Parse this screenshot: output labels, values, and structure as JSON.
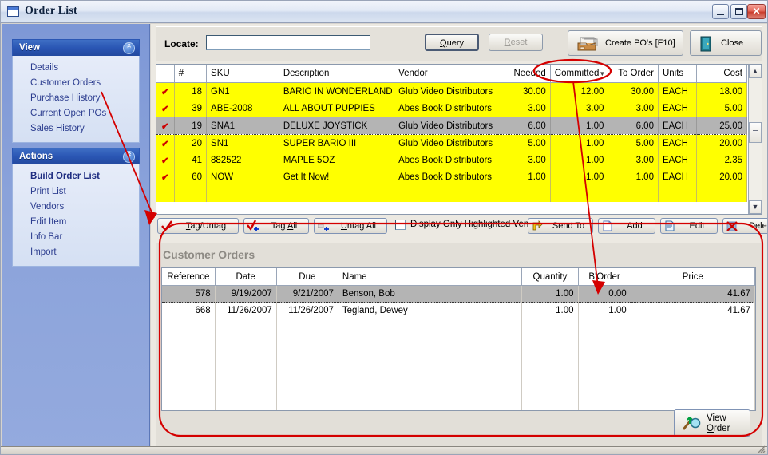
{
  "window": {
    "title": "Order List",
    "controls": {
      "minimize": "_",
      "maximize": "□",
      "close": "✕"
    }
  },
  "sidebar": {
    "panels": [
      {
        "title": "View",
        "collapse_icon": "chevron-up-icon",
        "items": [
          {
            "label": "Details",
            "bold": false
          },
          {
            "label": "Customer Orders",
            "bold": false
          },
          {
            "label": "Purchase History",
            "bold": false
          },
          {
            "label": "Current Open POs",
            "bold": false
          },
          {
            "label": "Sales History",
            "bold": false
          }
        ]
      },
      {
        "title": "Actions",
        "collapse_icon": "chevron-up-icon",
        "items": [
          {
            "label": "Build Order List",
            "bold": true
          },
          {
            "label": "Print List",
            "bold": false
          },
          {
            "label": "Vendors",
            "bold": false
          },
          {
            "label": "Edit Item",
            "bold": false
          },
          {
            "label": "Info Bar",
            "bold": false
          },
          {
            "label": "Import",
            "bold": false
          }
        ]
      }
    ]
  },
  "toolbar": {
    "locate_label": "Locate:",
    "locate_value": "",
    "locate_placeholder": "",
    "query_label": "Query",
    "query_accel": "Q",
    "reset_label": "Reset",
    "reset_accel": "R",
    "reset_disabled": true,
    "create_po_label": "Create PO's [F10]",
    "close_label": "Close"
  },
  "order_grid": {
    "columns": [
      "",
      "#",
      "SKU",
      "Description",
      "Vendor",
      "Needed",
      "Committed",
      "To Order",
      "Units",
      "Cost"
    ],
    "sorted_column": "Committed",
    "sort_indicator": "▼",
    "rows": [
      {
        "tagged": "✔",
        "num": "18",
        "sku": "GN1",
        "description": "BARIO IN WONDERLAND",
        "vendor": "Glub Video Distributors",
        "needed": "30.00",
        "committed": "12.00",
        "to_order": "30.00",
        "units": "EACH",
        "cost": "18.00",
        "selected": false
      },
      {
        "tagged": "✔",
        "num": "39",
        "sku": "ABE-2008",
        "description": "ALL ABOUT PUPPIES",
        "vendor": "Abes Book Distributors",
        "needed": "3.00",
        "committed": "3.00",
        "to_order": "3.00",
        "units": "EACH",
        "cost": "5.00",
        "selected": false
      },
      {
        "tagged": "✔",
        "num": "19",
        "sku": "SNA1",
        "description": "DELUXE JOYSTICK",
        "vendor": "Glub Video Distributors",
        "needed": "6.00",
        "committed": "1.00",
        "to_order": "6.00",
        "units": "EACH",
        "cost": "25.00",
        "selected": true
      },
      {
        "tagged": "✔",
        "num": "20",
        "sku": "SN1",
        "description": "SUPER BARIO III",
        "vendor": "Glub Video Distributors",
        "needed": "5.00",
        "committed": "1.00",
        "to_order": "5.00",
        "units": "EACH",
        "cost": "20.00",
        "selected": false
      },
      {
        "tagged": "✔",
        "num": "41",
        "sku": "882522",
        "description": "MAPLE 5OZ",
        "vendor": "Abes Book Distributors",
        "needed": "3.00",
        "committed": "1.00",
        "to_order": "3.00",
        "units": "EACH",
        "cost": "2.35",
        "selected": false
      },
      {
        "tagged": "✔",
        "num": "60",
        "sku": "NOW",
        "description": "Get It Now!",
        "vendor": "Abes Book Distributors",
        "needed": "1.00",
        "committed": "1.00",
        "to_order": "1.00",
        "units": "EACH",
        "cost": "20.00",
        "selected": false
      }
    ],
    "scrollbar": {
      "up": "▲",
      "down": "▼"
    }
  },
  "action_bar": {
    "tag_untag_label": "Tag/Untag",
    "tag_all_label": "Tag All",
    "untag_all_label": "Untag All",
    "display_only_label": "Display Only Highlighted Vendor",
    "display_only_checked": false,
    "send_to_label": "Send To",
    "add_label": "Add",
    "edit_label": "Edit",
    "delete_label": "Delete"
  },
  "customer_orders": {
    "title": "Customer Orders",
    "columns": [
      "Reference",
      "Date",
      "Due",
      "Name",
      "Quantity",
      "B'Order",
      "Price"
    ],
    "rows": [
      {
        "reference": "578",
        "date": "9/19/2007",
        "due": "9/21/2007",
        "name": "Benson, Bob",
        "quantity": "1.00",
        "border": "0.00",
        "price": "41.67",
        "selected": true
      },
      {
        "reference": "668",
        "date": "11/26/2007",
        "due": "11/26/2007",
        "name": "Tegland, Dewey",
        "quantity": "1.00",
        "border": "1.00",
        "price": "41.67",
        "selected": false
      }
    ],
    "view_order_line1": "View",
    "view_order_line2": "Order",
    "view_order_accel": "O"
  },
  "annotations": {
    "highlight_color": "#d40000",
    "ellipse_target": "Committed",
    "arrow_1": "from sidebar Customer Orders to Customer Orders panel",
    "arrow_2": "from Committed column header to B'Order cell",
    "rounded_rect_target": "Customer Orders panel"
  }
}
